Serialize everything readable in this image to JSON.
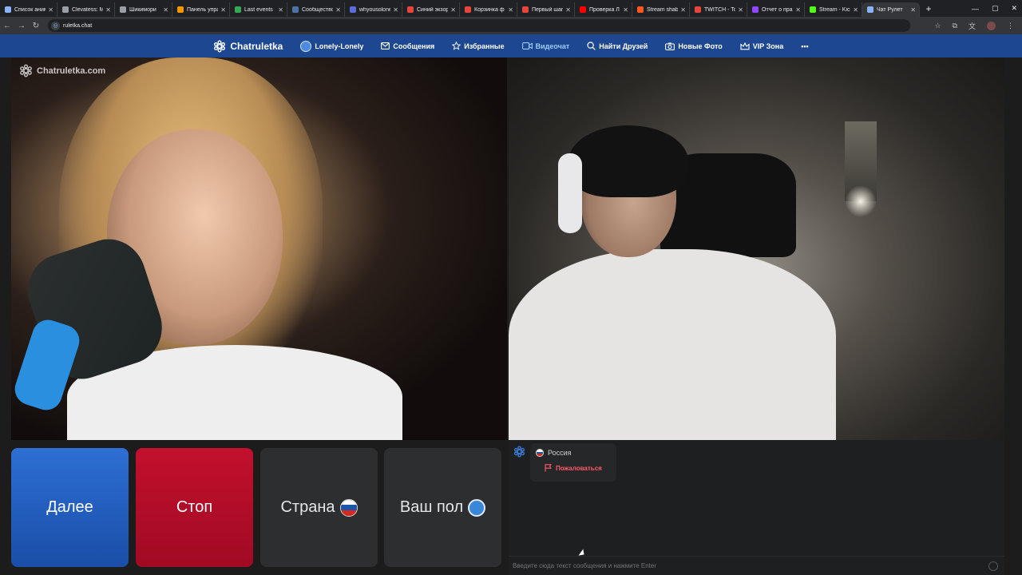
{
  "browser": {
    "tabs": [
      {
        "title": "Список анимe",
        "color": "#8ab4f8"
      },
      {
        "title": "Clevatess: M",
        "color": "#9aa0a6"
      },
      {
        "title": "Шикимори",
        "color": "#9aa0a6"
      },
      {
        "title": "Панель упра",
        "color": "#f29900"
      },
      {
        "title": "Last events",
        "color": "#34a853"
      },
      {
        "title": "Сообщество",
        "color": "#4c75a3"
      },
      {
        "title": "whyousolone",
        "color": "#5b6dd6"
      },
      {
        "title": "Синий экзор",
        "color": "#e8453c"
      },
      {
        "title": "Корзинка ф",
        "color": "#e8453c"
      },
      {
        "title": "Первый шаг",
        "color": "#e8453c"
      },
      {
        "title": "Проверка Л",
        "color": "#ff0000"
      },
      {
        "title": "Stream shab",
        "color": "#ff5722"
      },
      {
        "title": "TWITCH - Ton",
        "color": "#e8453c"
      },
      {
        "title": "Отчет о пра",
        "color": "#9146ff"
      },
      {
        "title": "Stream - Kick",
        "color": "#53fc18"
      },
      {
        "title": "Чат Рулет",
        "color": "#8ab4f8",
        "active": true
      }
    ],
    "new_tab": "+",
    "window_controls": [
      "—",
      "▢",
      "✕"
    ],
    "url": "ruletka.chat"
  },
  "site": {
    "logo": "Chatruletka",
    "nav": [
      {
        "label": "Lonely-Lonely",
        "icon": "user-avatar-icon"
      },
      {
        "label": "Сообщения",
        "icon": "mail-icon"
      },
      {
        "label": "Избранные",
        "icon": "star-icon"
      },
      {
        "label": "Видеочат",
        "icon": "video-camera-icon",
        "active": true
      },
      {
        "label": "Найти Друзей",
        "icon": "search-icon"
      },
      {
        "label": "Новые Фото",
        "icon": "camera-icon"
      },
      {
        "label": "VIP Зона",
        "icon": "crown-icon"
      },
      {
        "label": "•••",
        "icon": "more-icon"
      }
    ],
    "watermark": "Chatruletka.com"
  },
  "controls": {
    "next": "Далее",
    "stop": "Стоп",
    "country": "Страна",
    "gender": "Ваш пол"
  },
  "chat": {
    "partner_country": "Россия",
    "report": "Пожаловаться",
    "input_placeholder": "Введите сюда текст сообщения и нажмите Enter"
  },
  "colors": {
    "nav_bg": "#1d4790",
    "next_btn": "#2a66c8",
    "stop_btn": "#b30d28",
    "report_text": "#ff5a6a"
  }
}
